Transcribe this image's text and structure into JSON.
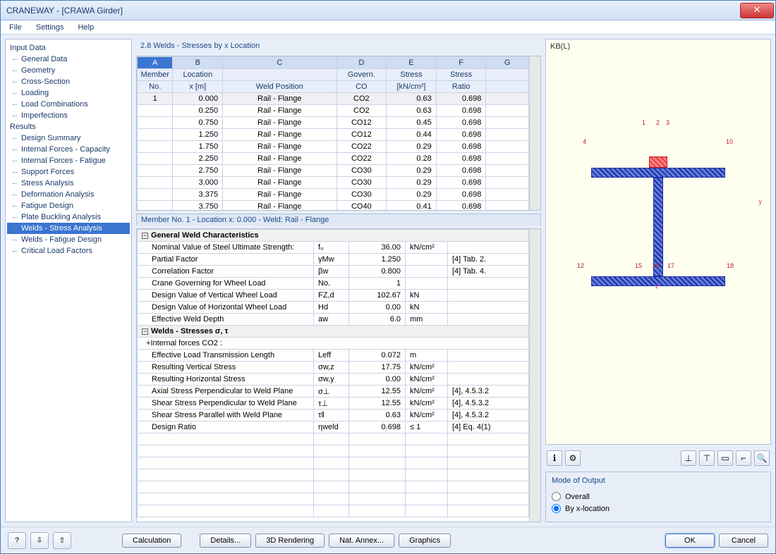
{
  "window": {
    "title": "CRANEWAY - [CRAWA Girder]"
  },
  "menu": {
    "file": "File",
    "settings": "Settings",
    "help": "Help"
  },
  "tree": {
    "input": "Input Data",
    "input_items": [
      "General Data",
      "Geometry",
      "Cross-Section",
      "Loading",
      "Load Combinations",
      "Imperfections"
    ],
    "results": "Results",
    "results_items": [
      "Design Summary",
      "Internal Forces - Capacity",
      "Internal Forces - Fatigue",
      "Support Forces",
      "Stress Analysis",
      "Deformation Analysis",
      "Fatigue Design",
      "Plate Buckling Analysis",
      "Welds - Stress Analysis",
      "Welds - Fatigue Design",
      "Critical Load Factors"
    ]
  },
  "section": {
    "title": "2.8 Welds - Stresses by x Location"
  },
  "grid": {
    "letters": [
      "A",
      "B",
      "C",
      "D",
      "E",
      "F",
      "G"
    ],
    "headers1": [
      "Member",
      "Location",
      "",
      "Govern.",
      "Stress",
      "Stress",
      ""
    ],
    "headers2": [
      "No.",
      "x [m]",
      "Weld Position",
      "CO",
      "[kN/cm²]",
      "Ratio",
      ""
    ],
    "rows": [
      {
        "m": "1",
        "x": "0.000",
        "pos": "Rail - Flange",
        "co": "CO2",
        "s": "0.63",
        "r": "0.698"
      },
      {
        "m": "",
        "x": "0.250",
        "pos": "Rail - Flange",
        "co": "CO2",
        "s": "0.63",
        "r": "0.698"
      },
      {
        "m": "",
        "x": "0.750",
        "pos": "Rail - Flange",
        "co": "CO12",
        "s": "0.45",
        "r": "0.698"
      },
      {
        "m": "",
        "x": "1.250",
        "pos": "Rail - Flange",
        "co": "CO12",
        "s": "0.44",
        "r": "0.698"
      },
      {
        "m": "",
        "x": "1.750",
        "pos": "Rail - Flange",
        "co": "CO22",
        "s": "0.29",
        "r": "0.698"
      },
      {
        "m": "",
        "x": "2.250",
        "pos": "Rail - Flange",
        "co": "CO22",
        "s": "0.28",
        "r": "0.698"
      },
      {
        "m": "",
        "x": "2.750",
        "pos": "Rail - Flange",
        "co": "CO30",
        "s": "0.29",
        "r": "0.698"
      },
      {
        "m": "",
        "x": "3.000",
        "pos": "Rail - Flange",
        "co": "CO30",
        "s": "0.29",
        "r": "0.698"
      },
      {
        "m": "",
        "x": "3.375",
        "pos": "Rail - Flange",
        "co": "CO30",
        "s": "0.29",
        "r": "0.698"
      },
      {
        "m": "",
        "x": "3.750",
        "pos": "Rail - Flange",
        "co": "CO40",
        "s": "0.41",
        "r": "0.698"
      }
    ]
  },
  "detail": {
    "header": "Member No.  1  -  Location x:  0.000  -  Weld: Rail - Flange",
    "group1": "General Weld Characteristics",
    "group2": "Welds - Stresses σ, τ",
    "sub2": "Internal forces CO2 :",
    "rows1": [
      {
        "name": "Nominal Value of Steel Ultimate Strength:",
        "sym": "fᵤ",
        "val": "36.00",
        "unit": "kN/cm²",
        "ref": ""
      },
      {
        "name": "Partial Factor",
        "sym": "γMw",
        "val": "1.250",
        "unit": "",
        "ref": "[4] Tab. 2."
      },
      {
        "name": "Correlation Factor",
        "sym": "βw",
        "val": "0.800",
        "unit": "",
        "ref": "[4] Tab. 4."
      },
      {
        "name": "Crane Governing for Wheel Load",
        "sym": "No.",
        "val": "1",
        "unit": "",
        "ref": ""
      },
      {
        "name": "Design Value of Vertical Wheel Load",
        "sym": "FZ,d",
        "val": "102.67",
        "unit": "kN",
        "ref": ""
      },
      {
        "name": "Design Value of Horizontal Wheel Load",
        "sym": "Hd",
        "val": "0.00",
        "unit": "kN",
        "ref": ""
      },
      {
        "name": "Effective Weld Depth",
        "sym": "aw",
        "val": "6.0",
        "unit": "mm",
        "ref": ""
      }
    ],
    "rows2": [
      {
        "name": "Effective Load Transmission Length",
        "sym": "Leff",
        "val": "0.072",
        "unit": "m",
        "ref": ""
      },
      {
        "name": "Resulting Vertical Stress",
        "sym": "σw,z",
        "val": "17.75",
        "unit": "kN/cm²",
        "ref": ""
      },
      {
        "name": "Resulting Horizontal Stress",
        "sym": "σw,y",
        "val": "0.00",
        "unit": "kN/cm²",
        "ref": ""
      },
      {
        "name": "Axial Stress Perpendicular to Weld Plane",
        "sym": "σ⊥",
        "val": "12.55",
        "unit": "kN/cm²",
        "ref": "[4], 4.5.3.2"
      },
      {
        "name": "Shear Stress Perpendicular to Weld Plane",
        "sym": "τ⊥",
        "val": "12.55",
        "unit": "kN/cm²",
        "ref": "[4], 4.5.3.2"
      },
      {
        "name": "Shear Stress Parallel with Weld Plane",
        "sym": "τ‖",
        "val": "0.63",
        "unit": "kN/cm²",
        "ref": "[4], 4.5.3.2"
      },
      {
        "name": "Design Ratio",
        "sym": "ηweld",
        "val": "0.698",
        "unit": "≤ 1",
        "ref": "[4] Eq. 4(1)"
      }
    ]
  },
  "viewer": {
    "label": "KB(L)"
  },
  "mode": {
    "title": "Mode of Output",
    "opt1": "Overall",
    "opt2": "By x-location"
  },
  "footer": {
    "calculation": "Calculation",
    "details": "Details...",
    "rendering": "3D Rendering",
    "annex": "Nat. Annex...",
    "graphics": "Graphics",
    "ok": "OK",
    "cancel": "Cancel"
  }
}
